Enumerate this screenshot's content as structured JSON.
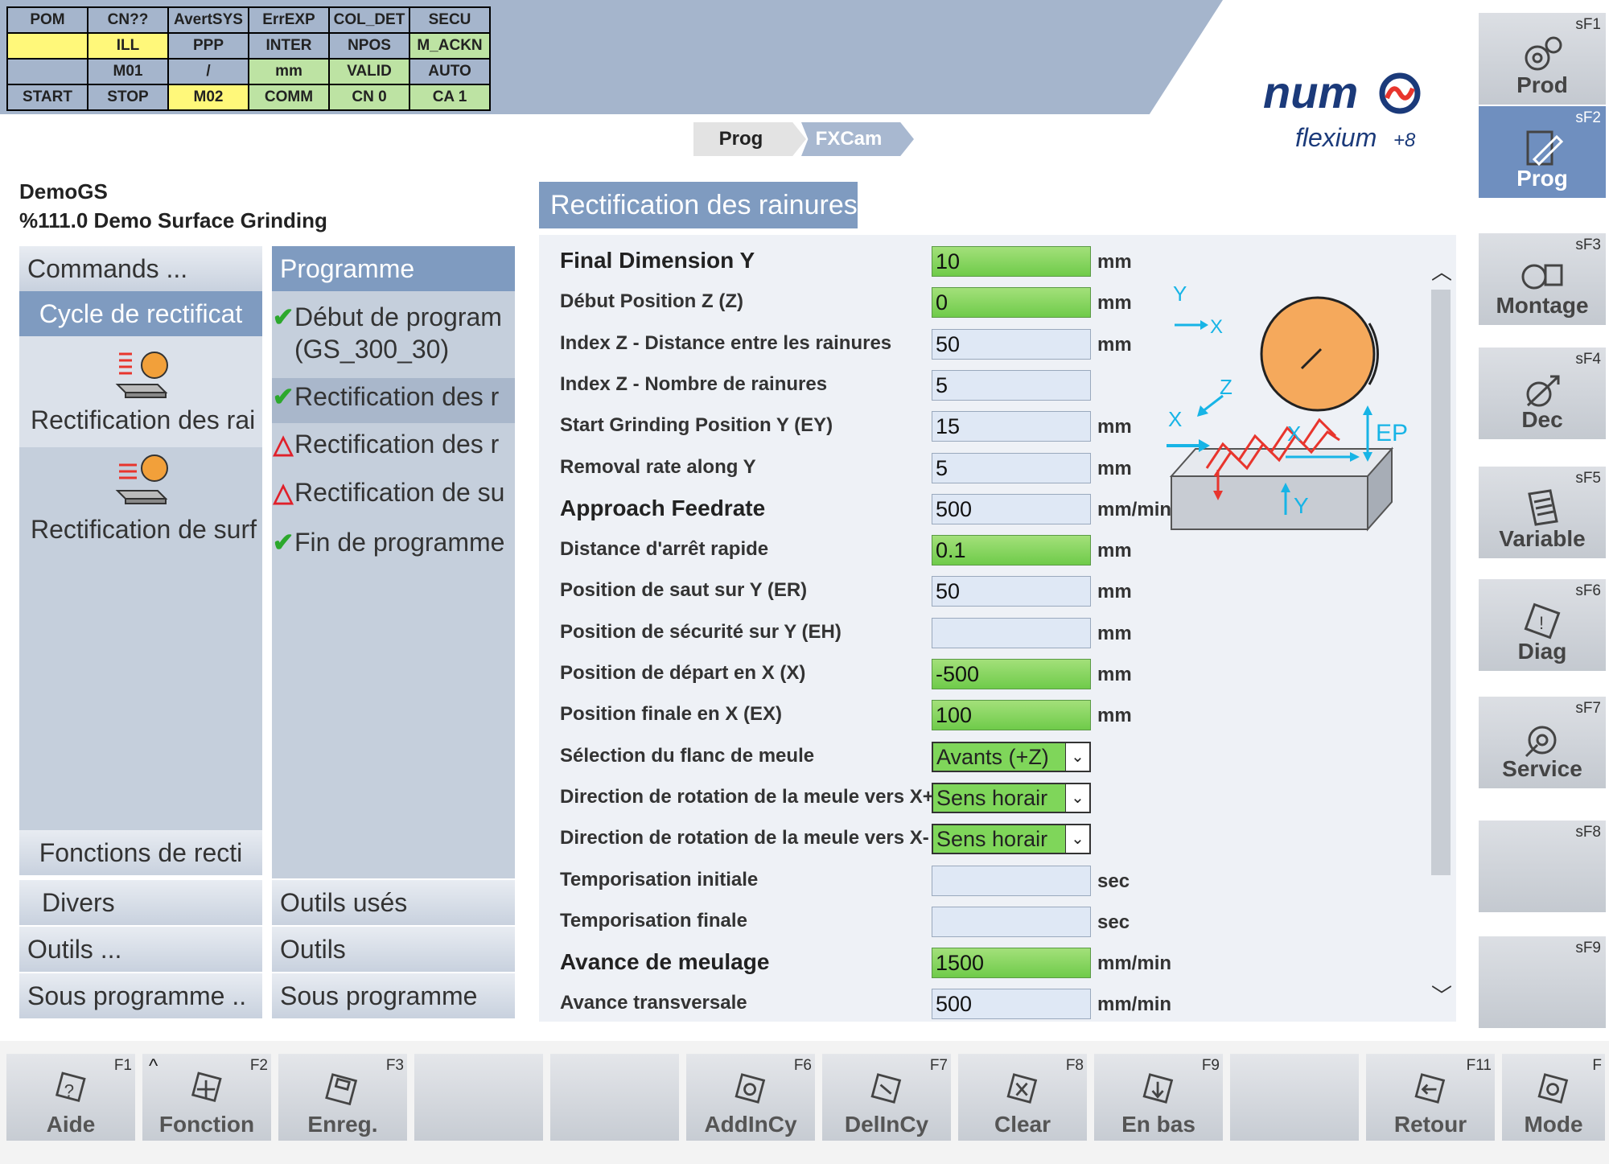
{
  "status": {
    "rows": [
      [
        {
          "t": "POM",
          "c": "grey"
        },
        {
          "t": "CN??",
          "c": "grey"
        },
        {
          "t": "AvertSYS",
          "c": "grey"
        },
        {
          "t": "ErrEXP",
          "c": "grey"
        },
        {
          "t": "COL_DET",
          "c": "grey"
        },
        {
          "t": "SECU",
          "c": "grey"
        }
      ],
      [
        {
          "t": "",
          "c": "yellow"
        },
        {
          "t": "ILL",
          "c": "yellow"
        },
        {
          "t": "PPP",
          "c": "grey"
        },
        {
          "t": "INTER",
          "c": "grey"
        },
        {
          "t": "NPOS",
          "c": "grey"
        },
        {
          "t": "M_ACKN",
          "c": "green"
        }
      ],
      [
        {
          "t": "",
          "c": "grey"
        },
        {
          "t": "M01",
          "c": "grey"
        },
        {
          "t": "/",
          "c": "grey"
        },
        {
          "t": "mm",
          "c": "green"
        },
        {
          "t": "VALID",
          "c": "green"
        },
        {
          "t": "AUTO",
          "c": "grey"
        }
      ],
      [
        {
          "t": "START",
          "c": "grey"
        },
        {
          "t": "STOP",
          "c": "grey"
        },
        {
          "t": "M02",
          "c": "yellow"
        },
        {
          "t": "COMM",
          "c": "green"
        },
        {
          "t": "CN 0",
          "c": "green"
        },
        {
          "t": "CA 1",
          "c": "green"
        }
      ]
    ]
  },
  "brand": {
    "logo": "num",
    "product": "flexium",
    "product_suffix": "+8"
  },
  "breadcrumb": {
    "item1": "Prog",
    "item2": "FXCam"
  },
  "program": {
    "name": "DemoGS",
    "description": "%111.0 Demo Surface Grinding"
  },
  "left_panel": {
    "commands": "Commands ...",
    "cycle_selected": "Cycle de rectificat",
    "cycle1_label": "Rectification des rai",
    "cycle2_label": "Rectification de surf",
    "fonctions": "Fonctions de recti",
    "divers": "Divers",
    "outils": "Outils ...",
    "sous_programme": "Sous programme .."
  },
  "mid_panel": {
    "header": "Programme",
    "items": [
      {
        "icon": "check",
        "line1": "Début de program",
        "line2": "(GS_300_30)"
      },
      {
        "icon": "check",
        "line1": "Rectification des r"
      },
      {
        "icon": "warn",
        "line1": "Rectification des r"
      },
      {
        "icon": "warn",
        "line1": "Rectification de su"
      },
      {
        "icon": "check",
        "line1": "Fin de programme"
      }
    ],
    "outils_uses": "Outils usés",
    "outils": "Outils",
    "sous_programme": "Sous programme"
  },
  "form": {
    "title": "Rectification des rainures",
    "rows": [
      {
        "label": "Final Dimension Y",
        "value": "10",
        "unit": "mm",
        "green": true,
        "big": true
      },
      {
        "label": "Début Position Z (Z)",
        "value": "0",
        "unit": "mm",
        "green": true
      },
      {
        "label": "Index Z - Distance entre les rainures",
        "value": "50",
        "unit": "mm"
      },
      {
        "label": "Index Z - Nombre de rainures",
        "value": "5",
        "unit": ""
      },
      {
        "label": "Start Grinding Position Y (EY)",
        "value": "15",
        "unit": "mm"
      },
      {
        "label": "Removal rate along Y",
        "value": "5",
        "unit": "mm"
      },
      {
        "label": "Approach Feedrate",
        "value": "500",
        "unit": "mm/min",
        "big": true
      },
      {
        "label": "Distance d'arrêt rapide",
        "value": "0.1",
        "unit": "mm",
        "green": true
      },
      {
        "label": "Position de saut sur Y (ER)",
        "value": "50",
        "unit": "mm"
      },
      {
        "label": "Position de sécurité sur Y (EH)",
        "value": "",
        "unit": "mm"
      },
      {
        "label": "Position de départ en X (X)",
        "value": "-500",
        "unit": "mm",
        "green": true
      },
      {
        "label": "Position finale en X (EX)",
        "value": "100",
        "unit": "mm",
        "green": true
      },
      {
        "label": "Sélection du flanc de meule",
        "value": "Avants (+Z)",
        "unit": "",
        "select": true
      },
      {
        "label": "Direction de rotation de la meule vers X+",
        "value": "Sens horair",
        "unit": "",
        "select": true
      },
      {
        "label": "Direction de rotation de la meule vers X-",
        "value": "Sens horair",
        "unit": "",
        "select": true
      },
      {
        "label": "Temporisation initiale",
        "value": "",
        "unit": "sec"
      },
      {
        "label": "Temporisation finale",
        "value": "",
        "unit": "sec"
      },
      {
        "label": "Avance de meulage",
        "value": "1500",
        "unit": "mm/min",
        "green": true,
        "big": true
      },
      {
        "label": "Avance transversale",
        "value": "500",
        "unit": "mm/min"
      }
    ],
    "diagram": {
      "y": "Y",
      "x": "X",
      "z": "Z",
      "ep": "EP",
      "x2": "X",
      "y2": "Y",
      "x3": "X"
    }
  },
  "softkeys_side": [
    {
      "key": "sF1",
      "label": "Prod",
      "icon": "gears-icon"
    },
    {
      "key": "sF2",
      "label": "Prog",
      "icon": "edit-icon",
      "active": true
    },
    {
      "key": "sF3",
      "label": "Montage",
      "icon": "setup-icon"
    },
    {
      "key": "sF4",
      "label": "Dec",
      "icon": "offset-icon"
    },
    {
      "key": "sF5",
      "label": "Variable",
      "icon": "document-icon"
    },
    {
      "key": "sF6",
      "label": "Diag",
      "icon": "warning-icon"
    },
    {
      "key": "sF7",
      "label": "Service",
      "icon": "wrench-gear-icon"
    },
    {
      "key": "sF8",
      "label": "",
      "icon": ""
    },
    {
      "key": "sF9",
      "label": "",
      "icon": ""
    }
  ],
  "softkeys_bottom": [
    {
      "key": "F1",
      "label": "Aide",
      "icon": "help-icon"
    },
    {
      "key": "F2",
      "label": "Fonction",
      "icon": "function-icon",
      "caret": "^"
    },
    {
      "key": "F3",
      "label": "Enreg.",
      "icon": "save-icon"
    },
    {
      "key": "",
      "label": "",
      "icon": ""
    },
    {
      "key": "",
      "label": "",
      "icon": ""
    },
    {
      "key": "F6",
      "label": "AddInCy",
      "icon": "add-cycle-icon"
    },
    {
      "key": "F7",
      "label": "DelInCy",
      "icon": "delete-cycle-icon"
    },
    {
      "key": "F8",
      "label": "Clear",
      "icon": "clear-icon"
    },
    {
      "key": "F9",
      "label": "En bas",
      "icon": "down-icon"
    },
    {
      "key": "",
      "label": "",
      "icon": ""
    },
    {
      "key": "F11",
      "label": "Retour",
      "icon": "back-icon"
    },
    {
      "key": "F",
      "label": "Mode",
      "icon": "mode-icon"
    }
  ],
  "colors": {
    "accent": "#7f9bc0",
    "green_field": "#7fd65a",
    "status_bg": "#a5b5cc",
    "warn": "#e0202a",
    "ok": "#2ca82c",
    "diagram_cyan": "#17b4e6",
    "diagram_red": "#e8352d",
    "wheel": "#f5a95c"
  }
}
